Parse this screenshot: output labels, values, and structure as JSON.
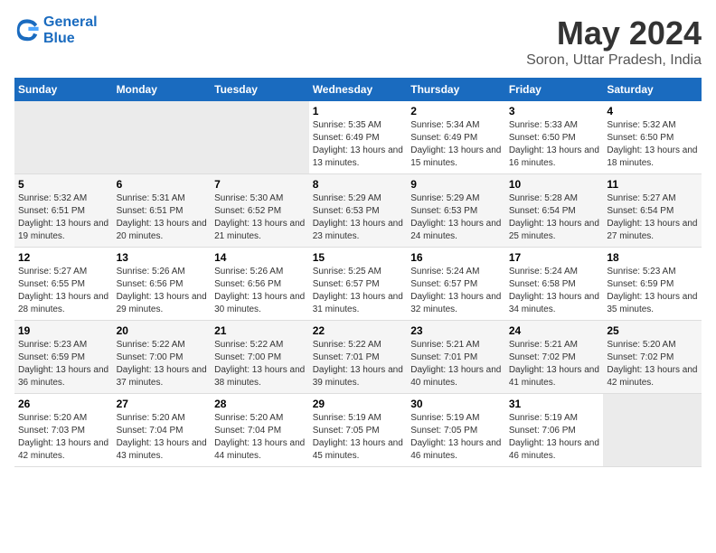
{
  "header": {
    "logo_line1": "General",
    "logo_line2": "Blue",
    "title": "May 2024",
    "subtitle": "Soron, Uttar Pradesh, India"
  },
  "calendar": {
    "days_of_week": [
      "Sunday",
      "Monday",
      "Tuesday",
      "Wednesday",
      "Thursday",
      "Friday",
      "Saturday"
    ],
    "weeks": [
      {
        "days": [
          {
            "num": "",
            "info": ""
          },
          {
            "num": "",
            "info": ""
          },
          {
            "num": "",
            "info": ""
          },
          {
            "num": "1",
            "info": "Sunrise: 5:35 AM\nSunset: 6:49 PM\nDaylight: 13 hours\nand 13 minutes."
          },
          {
            "num": "2",
            "info": "Sunrise: 5:34 AM\nSunset: 6:49 PM\nDaylight: 13 hours\nand 15 minutes."
          },
          {
            "num": "3",
            "info": "Sunrise: 5:33 AM\nSunset: 6:50 PM\nDaylight: 13 hours\nand 16 minutes."
          },
          {
            "num": "4",
            "info": "Sunrise: 5:32 AM\nSunset: 6:50 PM\nDaylight: 13 hours\nand 18 minutes."
          }
        ]
      },
      {
        "days": [
          {
            "num": "5",
            "info": "Sunrise: 5:32 AM\nSunset: 6:51 PM\nDaylight: 13 hours\nand 19 minutes."
          },
          {
            "num": "6",
            "info": "Sunrise: 5:31 AM\nSunset: 6:51 PM\nDaylight: 13 hours\nand 20 minutes."
          },
          {
            "num": "7",
            "info": "Sunrise: 5:30 AM\nSunset: 6:52 PM\nDaylight: 13 hours\nand 21 minutes."
          },
          {
            "num": "8",
            "info": "Sunrise: 5:29 AM\nSunset: 6:53 PM\nDaylight: 13 hours\nand 23 minutes."
          },
          {
            "num": "9",
            "info": "Sunrise: 5:29 AM\nSunset: 6:53 PM\nDaylight: 13 hours\nand 24 minutes."
          },
          {
            "num": "10",
            "info": "Sunrise: 5:28 AM\nSunset: 6:54 PM\nDaylight: 13 hours\nand 25 minutes."
          },
          {
            "num": "11",
            "info": "Sunrise: 5:27 AM\nSunset: 6:54 PM\nDaylight: 13 hours\nand 27 minutes."
          }
        ]
      },
      {
        "days": [
          {
            "num": "12",
            "info": "Sunrise: 5:27 AM\nSunset: 6:55 PM\nDaylight: 13 hours\nand 28 minutes."
          },
          {
            "num": "13",
            "info": "Sunrise: 5:26 AM\nSunset: 6:56 PM\nDaylight: 13 hours\nand 29 minutes."
          },
          {
            "num": "14",
            "info": "Sunrise: 5:26 AM\nSunset: 6:56 PM\nDaylight: 13 hours\nand 30 minutes."
          },
          {
            "num": "15",
            "info": "Sunrise: 5:25 AM\nSunset: 6:57 PM\nDaylight: 13 hours\nand 31 minutes."
          },
          {
            "num": "16",
            "info": "Sunrise: 5:24 AM\nSunset: 6:57 PM\nDaylight: 13 hours\nand 32 minutes."
          },
          {
            "num": "17",
            "info": "Sunrise: 5:24 AM\nSunset: 6:58 PM\nDaylight: 13 hours\nand 34 minutes."
          },
          {
            "num": "18",
            "info": "Sunrise: 5:23 AM\nSunset: 6:59 PM\nDaylight: 13 hours\nand 35 minutes."
          }
        ]
      },
      {
        "days": [
          {
            "num": "19",
            "info": "Sunrise: 5:23 AM\nSunset: 6:59 PM\nDaylight: 13 hours\nand 36 minutes."
          },
          {
            "num": "20",
            "info": "Sunrise: 5:22 AM\nSunset: 7:00 PM\nDaylight: 13 hours\nand 37 minutes."
          },
          {
            "num": "21",
            "info": "Sunrise: 5:22 AM\nSunset: 7:00 PM\nDaylight: 13 hours\nand 38 minutes."
          },
          {
            "num": "22",
            "info": "Sunrise: 5:22 AM\nSunset: 7:01 PM\nDaylight: 13 hours\nand 39 minutes."
          },
          {
            "num": "23",
            "info": "Sunrise: 5:21 AM\nSunset: 7:01 PM\nDaylight: 13 hours\nand 40 minutes."
          },
          {
            "num": "24",
            "info": "Sunrise: 5:21 AM\nSunset: 7:02 PM\nDaylight: 13 hours\nand 41 minutes."
          },
          {
            "num": "25",
            "info": "Sunrise: 5:20 AM\nSunset: 7:02 PM\nDaylight: 13 hours\nand 42 minutes."
          }
        ]
      },
      {
        "days": [
          {
            "num": "26",
            "info": "Sunrise: 5:20 AM\nSunset: 7:03 PM\nDaylight: 13 hours\nand 42 minutes."
          },
          {
            "num": "27",
            "info": "Sunrise: 5:20 AM\nSunset: 7:04 PM\nDaylight: 13 hours\nand 43 minutes."
          },
          {
            "num": "28",
            "info": "Sunrise: 5:20 AM\nSunset: 7:04 PM\nDaylight: 13 hours\nand 44 minutes."
          },
          {
            "num": "29",
            "info": "Sunrise: 5:19 AM\nSunset: 7:05 PM\nDaylight: 13 hours\nand 45 minutes."
          },
          {
            "num": "30",
            "info": "Sunrise: 5:19 AM\nSunset: 7:05 PM\nDaylight: 13 hours\nand 46 minutes."
          },
          {
            "num": "31",
            "info": "Sunrise: 5:19 AM\nSunset: 7:06 PM\nDaylight: 13 hours\nand 46 minutes."
          },
          {
            "num": "",
            "info": ""
          }
        ]
      }
    ]
  }
}
